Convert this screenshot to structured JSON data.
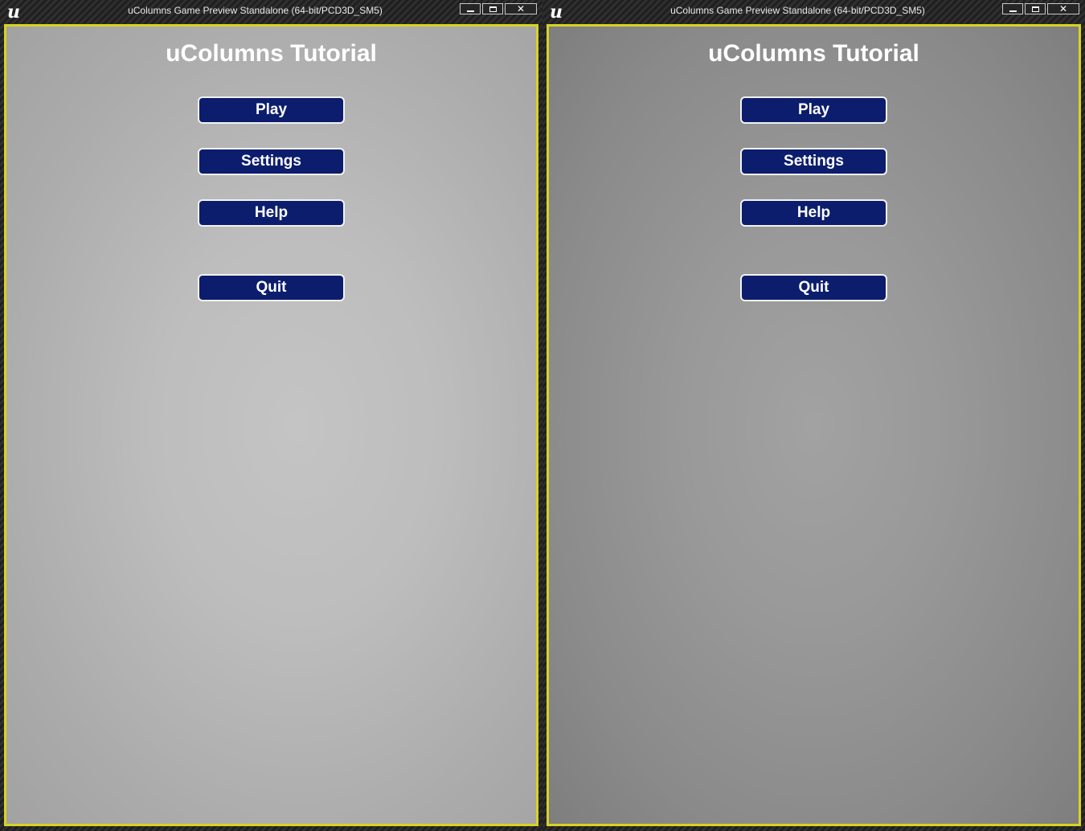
{
  "windows": [
    {
      "title": "uColumns Game Preview Standalone (64-bit/PCD3D_SM5)",
      "logo_icon": "unreal-engine-logo",
      "logo_glyph": "u",
      "controls": {
        "minimize_icon": "minimize-icon",
        "maximize_icon": "maximize-icon",
        "close_icon": "close-icon",
        "close_glyph": "✕"
      },
      "viewport": {
        "border_color": "#d8d322",
        "background_tone": "light-gray",
        "game_title": "uColumns Tutorial",
        "buttons": {
          "play": "Play",
          "settings": "Settings",
          "help": "Help",
          "quit": "Quit"
        }
      }
    },
    {
      "title": "uColumns Game Preview Standalone (64-bit/PCD3D_SM5)",
      "logo_icon": "unreal-engine-logo",
      "logo_glyph": "u",
      "controls": {
        "minimize_icon": "minimize-icon",
        "maximize_icon": "maximize-icon",
        "close_icon": "close-icon",
        "close_glyph": "✕"
      },
      "viewport": {
        "border_color": "#d8d322",
        "background_tone": "dark-gray",
        "game_title": "uColumns Tutorial",
        "buttons": {
          "play": "Play",
          "settings": "Settings",
          "help": "Help",
          "quit": "Quit"
        }
      }
    }
  ],
  "colors": {
    "button_fill": "#0c1d6e",
    "button_border": "#f2f2f2",
    "title_text": "#ffffff"
  }
}
